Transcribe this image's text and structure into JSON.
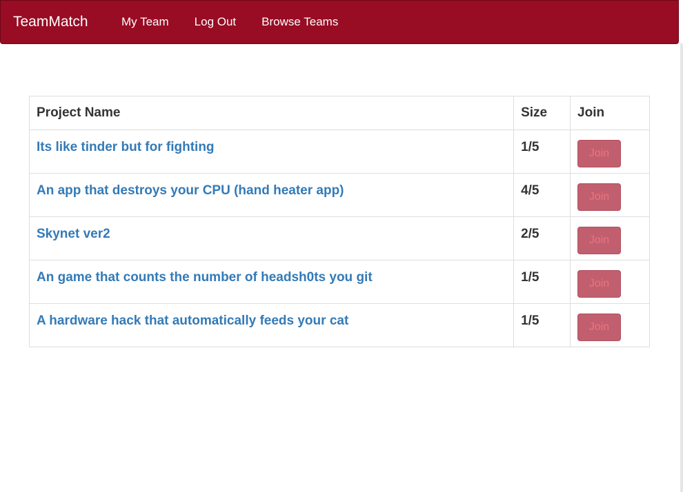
{
  "navbar": {
    "brand": "TeamMatch",
    "links": [
      "My Team",
      "Log Out",
      "Browse Teams"
    ]
  },
  "table": {
    "headers": {
      "project_name": "Project Name",
      "size": "Size",
      "join": "Join"
    },
    "rows": [
      {
        "name": "Its like tinder but for fighting",
        "size": "1/5",
        "join_label": "Join"
      },
      {
        "name": "An app that destroys your CPU (hand heater app)",
        "size": "4/5",
        "join_label": "Join"
      },
      {
        "name": "Skynet ver2",
        "size": "2/5",
        "join_label": "Join"
      },
      {
        "name": "An game that counts the number of headsh0ts you git",
        "size": "1/5",
        "join_label": "Join"
      },
      {
        "name": "A hardware hack that automatically feeds your cat",
        "size": "1/5",
        "join_label": "Join"
      }
    ]
  },
  "colors": {
    "navbar_bg": "#980c24",
    "link": "#337ab7",
    "join_button_bg": "#c25f6f",
    "join_button_text": "#e8757f"
  }
}
